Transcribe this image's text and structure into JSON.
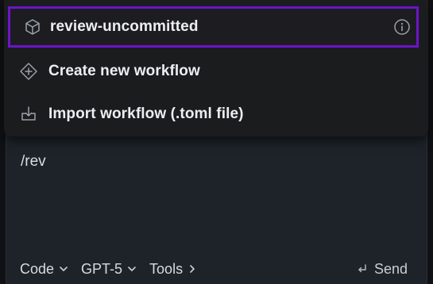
{
  "menu": {
    "items": [
      {
        "label": "review-uncommitted",
        "icon": "cube-icon",
        "selected": true
      },
      {
        "label": "Create new workflow",
        "icon": "diamond-plus-icon"
      },
      {
        "label": "Import workflow (.toml file)",
        "icon": "import-icon"
      }
    ],
    "accent_color": "#6d14c8"
  },
  "composer": {
    "input_value": "/rev",
    "mode_label": "Code",
    "model_label": "GPT-5",
    "tools_label": "Tools",
    "send_label": "Send"
  }
}
